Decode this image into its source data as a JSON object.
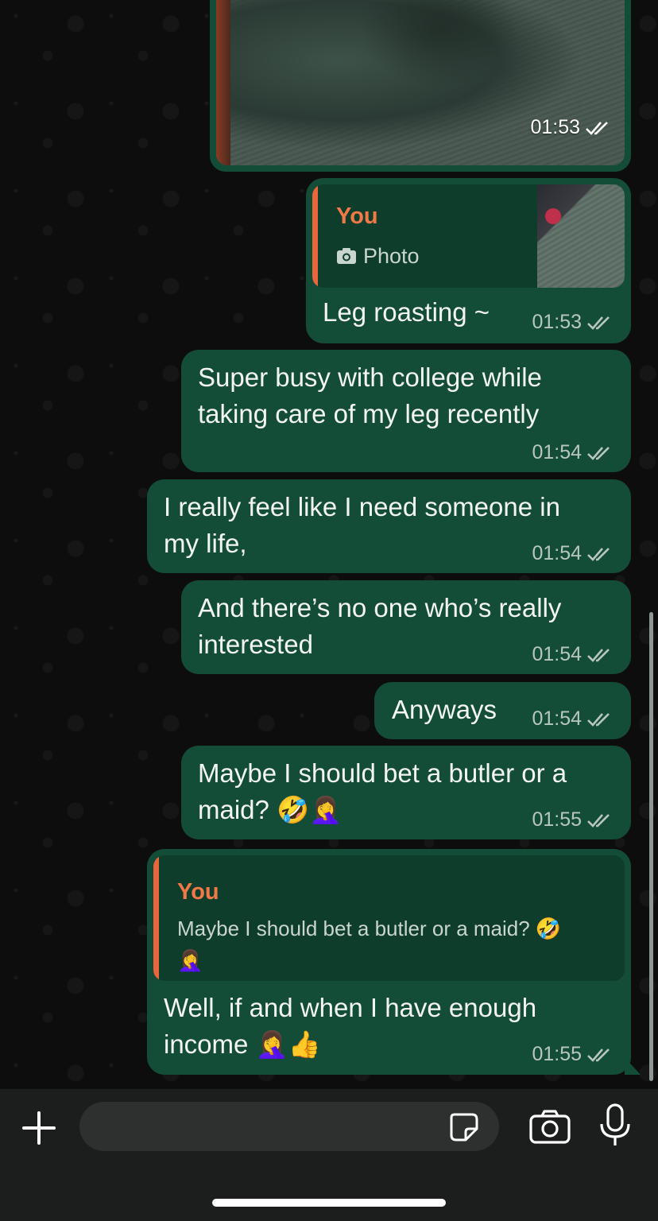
{
  "messages": [
    {
      "type": "photo",
      "time": "01:53"
    },
    {
      "type": "reply",
      "quote_author": "You",
      "quote_label": "Photo",
      "text": "Leg roasting ~",
      "time": "01:53"
    },
    {
      "type": "text",
      "text": "Super busy with college while\ntaking care of my leg recently",
      "time": "01:54"
    },
    {
      "type": "text",
      "text": "I really feel like I need someone in\nmy life,",
      "time": "01:54"
    },
    {
      "type": "text",
      "text": "And there’s no one who’s really\ninterested",
      "time": "01:54"
    },
    {
      "type": "text",
      "text": "Anyways",
      "time": "01:54"
    },
    {
      "type": "text",
      "text": "Maybe I should bet a butler or a\nmaid? 🤣🤦‍♀️",
      "time": "01:55"
    },
    {
      "type": "reply",
      "quote_author": "You",
      "quote_text": "Maybe I should bet a butler or a maid? 🤣\n🤦‍♀️",
      "text": "Well, if and when I have enough\nincome 🤦‍♀️👍",
      "time": "01:55"
    }
  ],
  "composer": {
    "placeholder": "",
    "value": ""
  },
  "colors": {
    "bubble_outgoing": "#144d37",
    "quote_bar": "#e8663c",
    "quote_author": "#f07a47",
    "background": "#0c0d0c"
  },
  "icons": [
    "camera-icon",
    "double-check-icon",
    "plus-icon",
    "sticker-icon",
    "microphone-icon"
  ]
}
